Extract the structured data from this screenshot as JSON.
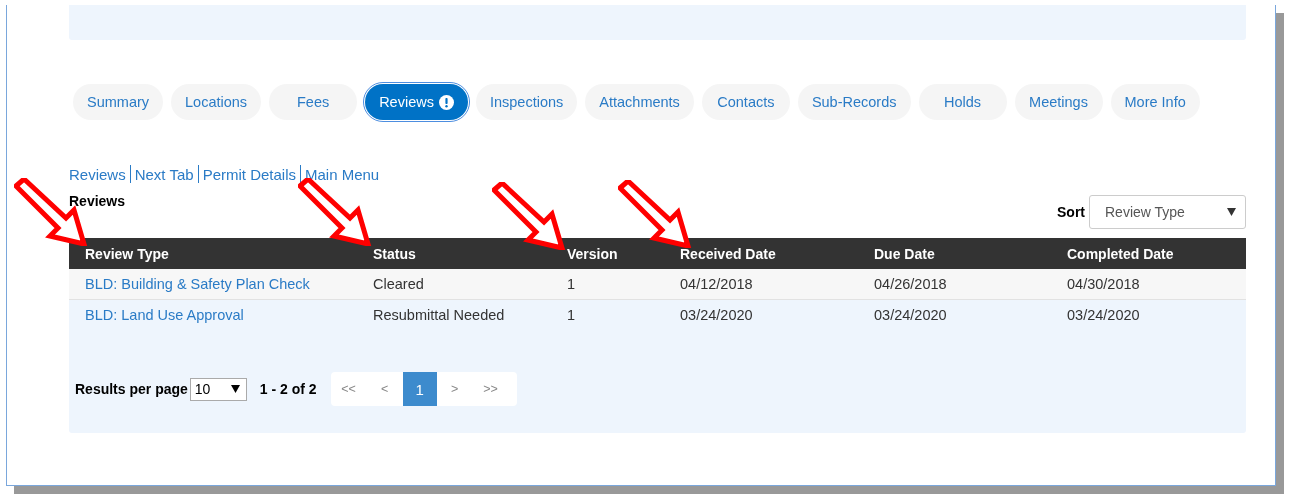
{
  "tabs": [
    {
      "label": "Summary",
      "selected": false,
      "alert": false
    },
    {
      "label": "Locations",
      "selected": false,
      "alert": false
    },
    {
      "label": "Fees",
      "selected": false,
      "alert": false
    },
    {
      "label": "Reviews",
      "selected": true,
      "alert": true
    },
    {
      "label": "Inspections",
      "selected": false,
      "alert": false
    },
    {
      "label": "Attachments",
      "selected": false,
      "alert": false
    },
    {
      "label": "Contacts",
      "selected": false,
      "alert": false
    },
    {
      "label": "Sub-Records",
      "selected": false,
      "alert": false
    },
    {
      "label": "Holds",
      "selected": false,
      "alert": false
    },
    {
      "label": "Meetings",
      "selected": false,
      "alert": false
    },
    {
      "label": "More Info",
      "selected": false,
      "alert": false
    }
  ],
  "breadcrumb_links": [
    "Reviews",
    "Next Tab",
    "Permit Details",
    "Main Menu"
  ],
  "section_title": "Reviews",
  "sort": {
    "label": "Sort",
    "value": "Review Type"
  },
  "table": {
    "columns": [
      "Review Type",
      "Status",
      "Version",
      "Received Date",
      "Due Date",
      "Completed Date"
    ],
    "rows": [
      [
        "BLD: Building & Safety Plan Check",
        "Cleared",
        "1",
        "04/12/2018",
        "04/26/2018",
        "04/30/2018"
      ],
      [
        "BLD: Land Use Approval",
        "Resubmittal Needed",
        "1",
        "03/24/2020",
        "03/24/2020",
        "03/24/2020"
      ]
    ]
  },
  "pagination": {
    "results_label": "Results per page",
    "per_page": "10",
    "range": "1 - 2 of 2",
    "pages": [
      {
        "label": "<<",
        "selected": false
      },
      {
        "label": "<",
        "selected": false
      },
      {
        "label": "1",
        "selected": true
      },
      {
        "label": ">",
        "selected": false
      },
      {
        "label": ">>",
        "selected": false
      }
    ]
  }
}
